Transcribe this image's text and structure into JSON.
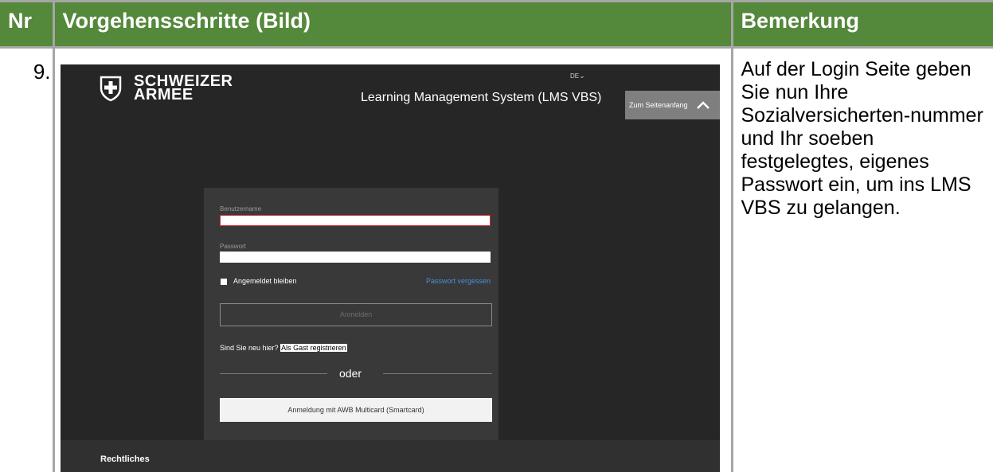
{
  "table": {
    "headers": {
      "nr": "Nr",
      "steps": "Vorgehensschritte (Bild)",
      "remark": "Bemerkung"
    },
    "rows": [
      {
        "nr": "9.",
        "remark": "Auf der Login Seite geben Sie nun Ihre Sozialversicherten-nummer und Ihr soeben festgelegtes, eigenes Passwort ein, um ins LMS VBS zu gelangen."
      }
    ]
  },
  "screenshot": {
    "brand": {
      "line1": "SCHWEIZER",
      "line2": "ARMEE",
      "icon": "swiss-cross-shield-icon"
    },
    "language": "DE",
    "app_title": "Learning Management System (LMS VBS)",
    "scroll_top_label": "Zum Seitenanfang",
    "login": {
      "username_label": "Benutzername",
      "username_value": "",
      "password_label": "Passwort",
      "password_value": "",
      "remember_label": "Angemeldet bleiben",
      "forgot_label": "Passwort vergessen",
      "login_label": "Anmelden",
      "new_prompt": "Sind Sie neu hier?",
      "guest_label": "Als Gast registrieren",
      "or_label": "oder",
      "smartcard_label": "Anmeldung mit AWB Multicard (Smartcard)"
    },
    "footer": {
      "legal_label": "Rechtliches"
    }
  },
  "colors": {
    "header_green": "#54883a",
    "grid_gray": "#a6a6a6",
    "app_dark": "#262626",
    "card": "#393939",
    "link_blue": "#4a8fd9",
    "error_red": "#d9262c"
  }
}
